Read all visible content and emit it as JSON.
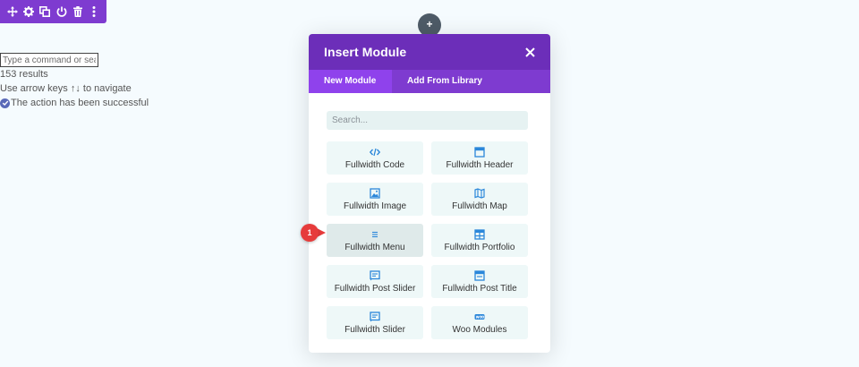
{
  "toolbar": {
    "items": [
      {
        "icon": "move-icon"
      },
      {
        "icon": "gear-icon"
      },
      {
        "icon": "duplicate-icon"
      },
      {
        "icon": "power-icon"
      },
      {
        "icon": "trash-icon"
      },
      {
        "icon": "more-vertical-icon"
      }
    ],
    "color": "#7e3bd0"
  },
  "command_palette": {
    "placeholder": "Type a command or search",
    "results": "153 results",
    "hint": "Use arrow keys ↑↓ to navigate",
    "status": "The action has been successful"
  },
  "add_button": {
    "label": "+"
  },
  "modal": {
    "title": "Insert Module",
    "tabs": [
      {
        "label": "New Module",
        "active": true
      },
      {
        "label": "Add From Library",
        "active": false
      }
    ],
    "search_placeholder": "Search...",
    "modules": [
      {
        "label": "Fullwidth Code",
        "icon": "code-icon"
      },
      {
        "label": "Fullwidth Header",
        "icon": "header-icon"
      },
      {
        "label": "Fullwidth Image",
        "icon": "image-icon"
      },
      {
        "label": "Fullwidth Map",
        "icon": "map-icon"
      },
      {
        "label": "Fullwidth Menu",
        "icon": "menu-icon"
      },
      {
        "label": "Fullwidth Portfolio",
        "icon": "portfolio-icon"
      },
      {
        "label": "Fullwidth Post Slider",
        "icon": "post-slider-icon"
      },
      {
        "label": "Fullwidth Post Title",
        "icon": "post-title-icon"
      },
      {
        "label": "Fullwidth Slider",
        "icon": "slider-icon"
      },
      {
        "label": "Woo Modules",
        "icon": "woo-icon"
      }
    ],
    "colors": {
      "header": "#6c2eb9",
      "tabs": "#7e3bd0",
      "active_tab": "#8f42ec",
      "icon": "#2b87da"
    }
  },
  "annotation": {
    "label": "1",
    "color": "#e63b3b"
  }
}
